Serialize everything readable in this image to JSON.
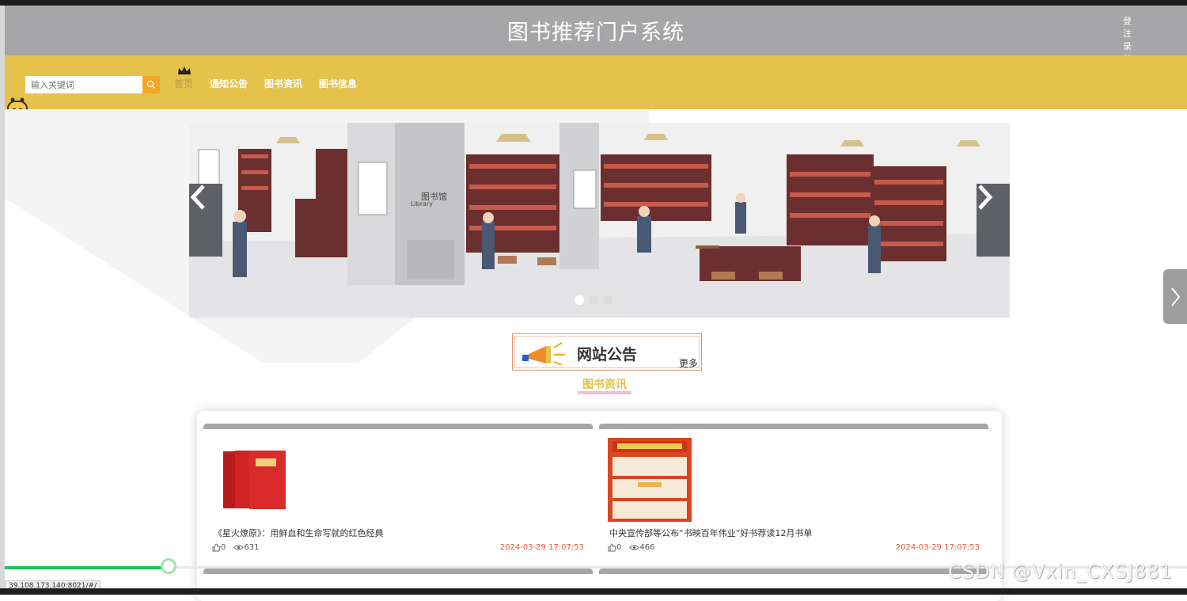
{
  "header": {
    "title": "图书推荐门户系统",
    "login": "登 注",
    "register": "录 册"
  },
  "search": {
    "placeholder": "输入关键词"
  },
  "nav": {
    "items": [
      {
        "label": "首页"
      },
      {
        "label": "通知公告"
      },
      {
        "label": "图书资讯"
      },
      {
        "label": "图书信息"
      }
    ]
  },
  "carousel": {
    "slide_count": 3,
    "active_index": 0,
    "sign_text": "图书馆",
    "sign_sub": "Library"
  },
  "notice": {
    "title": "网站公告",
    "more": "更多"
  },
  "section": {
    "title": "图书资讯"
  },
  "news": [
    {
      "title": "《星火燎原》：用鲜血和生命写就的红色经典",
      "likes": "0",
      "views": "631",
      "date": "2024-03-29 17:07:53"
    },
    {
      "title": "中央宣传部等公布“书映百年伟业”好书荐读12月书单",
      "likes": "0",
      "views": "466",
      "date": "2024-03-29 17:07:53"
    }
  ],
  "player": {
    "progress": 0.14
  },
  "status_url": "39.108.173.140:8021/#/",
  "watermark": "CSDN @Vxin_CXSJ881",
  "colors": {
    "header_bg": "#a6a6a8",
    "nav_bg": "#e5c24b",
    "date": "#e35b3b",
    "search_button": "#f5a623"
  }
}
